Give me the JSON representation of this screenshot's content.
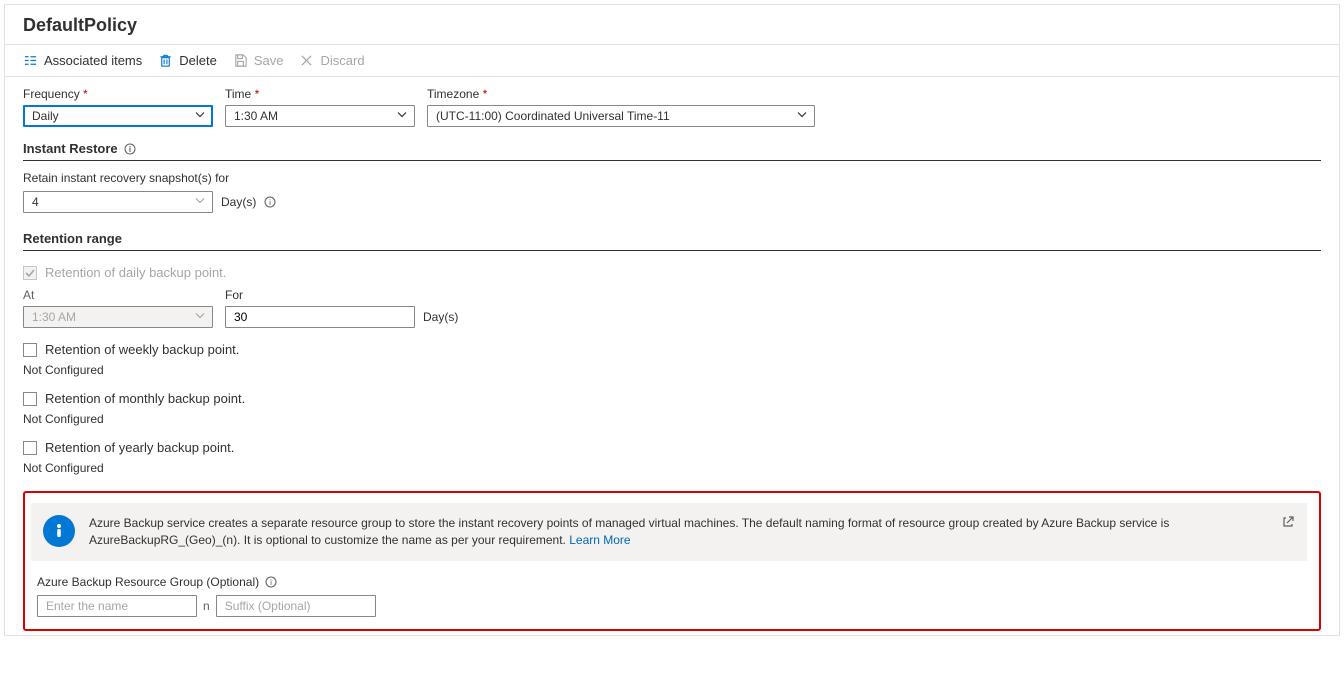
{
  "header": {
    "title": "DefaultPolicy"
  },
  "toolbar": {
    "assoc": "Associated items",
    "delete": "Delete",
    "save": "Save",
    "discard": "Discard"
  },
  "frequency": {
    "label": "Frequency",
    "value": "Daily"
  },
  "time": {
    "label": "Time",
    "value": "1:30 AM"
  },
  "timezone": {
    "label": "Timezone",
    "value": "(UTC-11:00) Coordinated Universal Time-11"
  },
  "instant": {
    "heading": "Instant Restore",
    "retain_label": "Retain instant recovery snapshot(s) for",
    "retain_value": "4",
    "unit": "Day(s)"
  },
  "retention": {
    "heading": "Retention range",
    "daily_label": "Retention of daily backup point.",
    "at_label": "At",
    "at_value": "1:30 AM",
    "for_label": "For",
    "for_value": "30",
    "for_unit": "Day(s)",
    "weekly_label": "Retention of weekly backup point.",
    "monthly_label": "Retention of monthly backup point.",
    "yearly_label": "Retention of yearly backup point.",
    "not_configured": "Not Configured"
  },
  "rg": {
    "info": "Azure Backup service creates a separate resource group to store the instant recovery points of managed virtual machines. The default naming format of resource group created by Azure Backup service is AzureBackupRG_(Geo)_(n). It is optional to customize the name as per your requirement.",
    "learn_more": "Learn More",
    "label": "Azure Backup Resource Group (Optional)",
    "prefix_ph": "Enter the name",
    "sep": "n",
    "suffix_ph": "Suffix (Optional)"
  }
}
